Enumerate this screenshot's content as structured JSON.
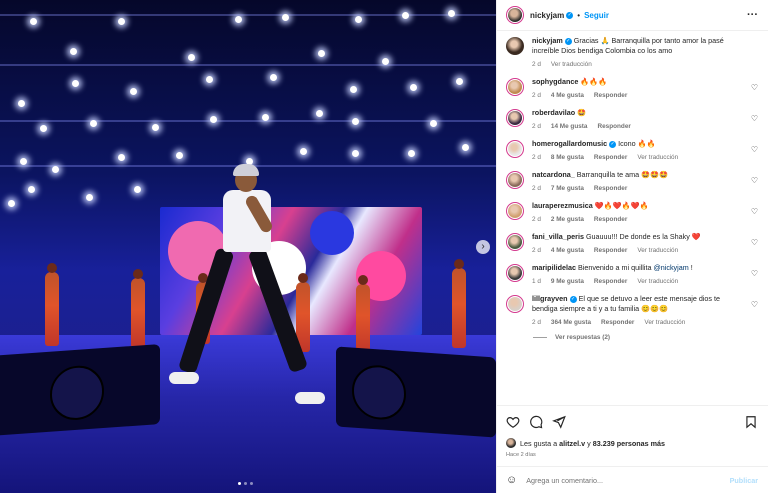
{
  "post": {
    "author": "nickyjam",
    "follow_label": "Seguir",
    "more_icon": "more-horizontal-icon",
    "next_icon": "chevron-right-icon",
    "carousel_pages": 3,
    "carousel_active": 1
  },
  "comments": [
    {
      "user": "nickyjam",
      "verified": true,
      "text": "Gracias 🙏 Barranquilla por tanto amor la pasé increíble Dios bendiga Colombia co los amo",
      "time": "2 d",
      "likes": "",
      "reply": "",
      "translate": "Ver traducción",
      "has_heart": false,
      "avatar_color": "#3a2a20"
    },
    {
      "user": "sophygdance",
      "verified": false,
      "text": "🔥🔥🔥",
      "time": "2 d",
      "likes": "4 Me gusta",
      "reply": "Responder",
      "translate": "",
      "has_heart": true,
      "avatar_color": "#c08a50"
    },
    {
      "user": "roberdavilao",
      "verified": false,
      "text": "🤩",
      "time": "2 d",
      "likes": "14 Me gusta",
      "reply": "Responder",
      "translate": "",
      "has_heart": true,
      "avatar_color": "#3a2a40"
    },
    {
      "user": "homerogallardomusic",
      "verified": true,
      "text": "Icono 🔥🔥",
      "time": "2 d",
      "likes": "8 Me gusta",
      "reply": "Responder",
      "translate": "Ver traducción",
      "has_heart": true,
      "avatar_color": "#e8e8e8"
    },
    {
      "user": "natcardona_",
      "verified": false,
      "text": "Barranquilla te ama 🤩🤩🤩",
      "time": "2 d",
      "likes": "7 Me gusta",
      "reply": "Responder",
      "translate": "",
      "has_heart": true,
      "avatar_color": "#8a6a5a"
    },
    {
      "user": "lauraperezmusica",
      "verified": false,
      "text": "❤️🔥❤️🔥❤️🔥",
      "time": "2 d",
      "likes": "2 Me gusta",
      "reply": "Responder",
      "translate": "",
      "has_heart": true,
      "avatar_color": "#d0a070"
    },
    {
      "user": "fani_villa_peris",
      "verified": false,
      "text": "Guauuu!!! De donde es la Shaky ❤️",
      "time": "2 d",
      "likes": "4 Me gusta",
      "reply": "Responder",
      "translate": "Ver traducción",
      "has_heart": true,
      "avatar_color": "#4a5a40"
    },
    {
      "user": "maripilidelac",
      "verified": false,
      "text": "Bienvenido a mi quillita",
      "mention": "@nickyjam",
      "mention_suffix": " !",
      "time": "1 d",
      "likes": "9 Me gusta",
      "reply": "Responder",
      "translate": "Ver traducción",
      "has_heart": true,
      "avatar_color": "#3a3a3a"
    },
    {
      "user": "lillgrayven",
      "verified": true,
      "text": "El que se detuvo a leer este mensaje dios te bendiga siempre a ti y a tu familia 😊😊😊",
      "time": "2 d",
      "likes": "364 Me gusta",
      "reply": "Responder",
      "translate": "Ver traducción",
      "has_heart": true,
      "avatar_color": "#d8d0c8"
    }
  ],
  "replies_label": "Ver respuestas (2)",
  "actions": {
    "like_icon": "heart-icon",
    "comment_icon": "comment-icon",
    "share_icon": "share-icon",
    "save_icon": "bookmark-icon"
  },
  "likes": {
    "prefix": "Les gusta a ",
    "user": "alitzel.v",
    "connector": " y ",
    "count": "83.239 personas más"
  },
  "date": "Hace 2 días",
  "add_comment": {
    "emoji_icon": "smiley-icon",
    "placeholder": "Agrega un comentario...",
    "publish_label": "Publicar"
  }
}
